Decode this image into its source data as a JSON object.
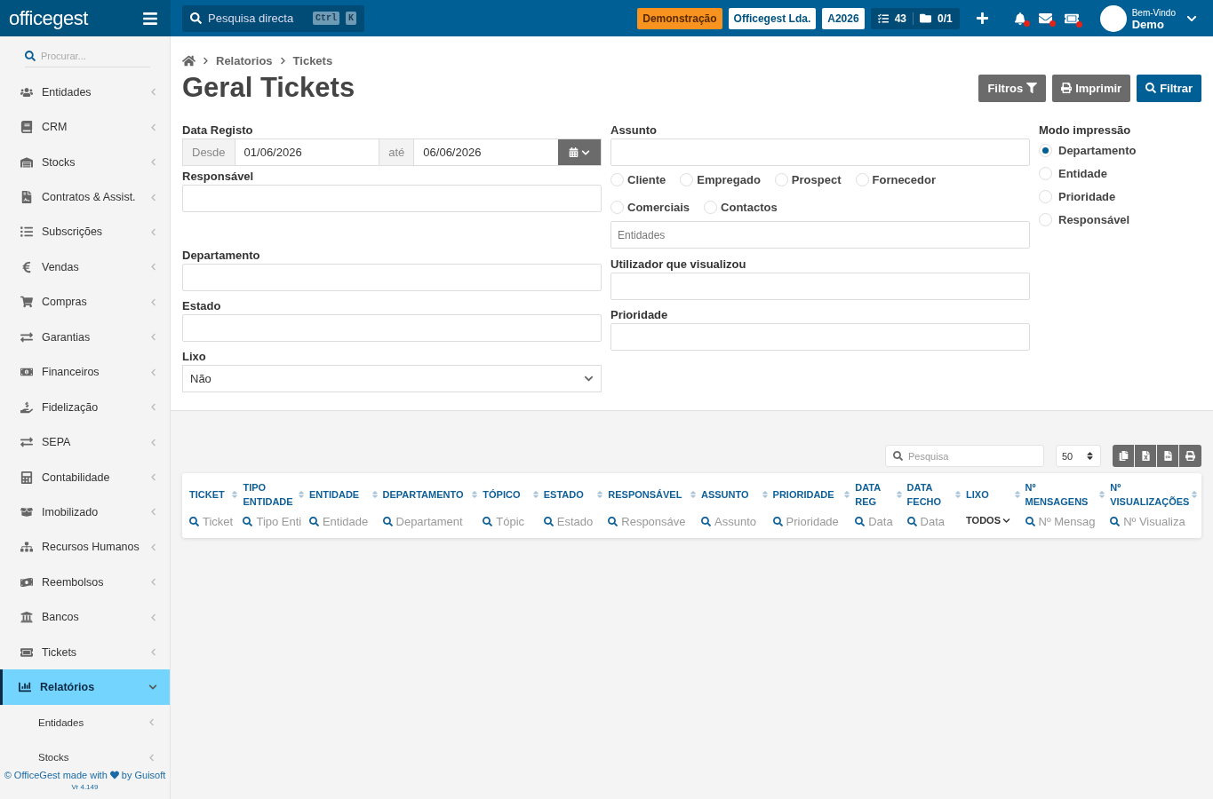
{
  "topbar": {
    "logo": "officegest",
    "search": {
      "placeholder": "Pesquisa directa",
      "keys": [
        "Ctrl",
        "K"
      ]
    },
    "badges": [
      {
        "kind": "demo",
        "label": "Demonstração"
      },
      {
        "kind": "plain",
        "label": "Officegest Lda."
      },
      {
        "kind": "plain",
        "label": "A2026"
      }
    ],
    "counters": [
      "43",
      "0/1"
    ],
    "user": {
      "greeting": "Bem-Vindo",
      "name": "Demo"
    }
  },
  "sidebar": {
    "search": {
      "placeholder": "Procurar..."
    },
    "items": [
      {
        "label": "Entidades",
        "selected": false,
        "expanded": false
      },
      {
        "label": "CRM",
        "selected": false,
        "expanded": false
      },
      {
        "label": "Stocks",
        "selected": false,
        "expanded": false
      },
      {
        "label": "Contratos & Assist.",
        "selected": false,
        "expanded": false
      },
      {
        "label": "Subscrições",
        "selected": false,
        "expanded": false
      },
      {
        "label": "Vendas",
        "selected": false,
        "expanded": false
      },
      {
        "label": "Compras",
        "selected": false,
        "expanded": false
      },
      {
        "label": "Garantias",
        "selected": false,
        "expanded": false
      },
      {
        "label": "Financeiros",
        "selected": false,
        "expanded": false
      },
      {
        "label": "Fidelização",
        "selected": false,
        "expanded": false
      },
      {
        "label": "SEPA",
        "selected": false,
        "expanded": false
      },
      {
        "label": "Contabilidade",
        "selected": false,
        "expanded": false
      },
      {
        "label": "Imobilizado",
        "selected": false,
        "expanded": false
      },
      {
        "label": "Recursos Humanos",
        "selected": false,
        "expanded": false
      },
      {
        "label": "Reembolsos",
        "selected": false,
        "expanded": false
      },
      {
        "label": "Bancos",
        "selected": false,
        "expanded": false
      },
      {
        "label": "Tickets",
        "selected": false,
        "expanded": false
      },
      {
        "label": "Relatórios",
        "selected": true,
        "expanded": true,
        "children": [
          {
            "label": "Entidades"
          },
          {
            "label": "Stocks"
          }
        ]
      }
    ],
    "footer": {
      "before": "© OfficeGest made with",
      "after": "by Guisoft",
      "version": "Vr 4.149"
    }
  },
  "breadcrumb": [
    "Relatorios",
    "Tickets"
  ],
  "title": "Geral Tickets",
  "actions": [
    {
      "kind": "secondary",
      "label": "Filtros"
    },
    {
      "kind": "secondary",
      "label": "Imprimir"
    },
    {
      "kind": "primary",
      "label": "Filtrar"
    }
  ],
  "filters": {
    "data_registo": {
      "label": "Data Registo",
      "from_label": "Desde",
      "from": "01/06/2026",
      "to_label": "até",
      "to": "06/06/2026"
    },
    "responsavel": {
      "label": "Responsável"
    },
    "departamento": {
      "label": "Departamento"
    },
    "estado": {
      "label": "Estado"
    },
    "lixo": {
      "label": "Lixo",
      "value": "Não"
    },
    "assunto": {
      "label": "Assunto"
    },
    "entity_types": [
      {
        "label": "Cliente",
        "selected": false
      },
      {
        "label": "Empregado",
        "selected": false
      },
      {
        "label": "Prospect",
        "selected": false
      },
      {
        "label": "Fornecedor",
        "selected": false
      },
      {
        "label": "Comerciais",
        "selected": false
      },
      {
        "label": "Contactos",
        "selected": false
      }
    ],
    "entidades": {
      "placeholder": "Entidades"
    },
    "utilizador": {
      "label": "Utilizador que visualizou"
    },
    "prioridade": {
      "label": "Prioridade"
    },
    "modo_impressao": {
      "label": "Modo impressão",
      "options": [
        {
          "label": "Departamento",
          "selected": true
        },
        {
          "label": "Entidade",
          "selected": false
        },
        {
          "label": "Prioridade",
          "selected": false
        },
        {
          "label": "Responsável",
          "selected": false
        }
      ]
    }
  },
  "table": {
    "search": {
      "placeholder": "Pesquisa"
    },
    "page_size": "50",
    "columns": [
      {
        "label": "TICKET",
        "kind": "search",
        "placeholder": "Ticket"
      },
      {
        "label": "TIPO ENTIDADE",
        "kind": "search",
        "placeholder": "Tipo Enti"
      },
      {
        "label": "ENTIDADE",
        "kind": "search",
        "placeholder": "Entidade"
      },
      {
        "label": "DEPARTAMENTO",
        "kind": "search",
        "placeholder": "Departament"
      },
      {
        "label": "TÓPICO",
        "kind": "search",
        "placeholder": "Tópic"
      },
      {
        "label": "ESTADO",
        "kind": "search",
        "placeholder": "Estado"
      },
      {
        "label": "RESPONSÁVEL",
        "kind": "search",
        "placeholder": "Responsáve"
      },
      {
        "label": "ASSUNTO",
        "kind": "search",
        "placeholder": "Assunto"
      },
      {
        "label": "PRIORIDADE",
        "kind": "search",
        "placeholder": "Prioridade"
      },
      {
        "label": "DATA REG",
        "kind": "search",
        "placeholder": "Data"
      },
      {
        "label": "DATA FECHO",
        "kind": "search",
        "placeholder": "Data"
      },
      {
        "label": "LIXO",
        "kind": "select",
        "value": "TODOS"
      },
      {
        "label": "Nº MENSAGENS",
        "kind": "search",
        "placeholder": "Nº Mensag"
      },
      {
        "label": "Nº VISUALIZAÇÕES",
        "kind": "search",
        "placeholder": "Nº Visualiza"
      }
    ]
  }
}
